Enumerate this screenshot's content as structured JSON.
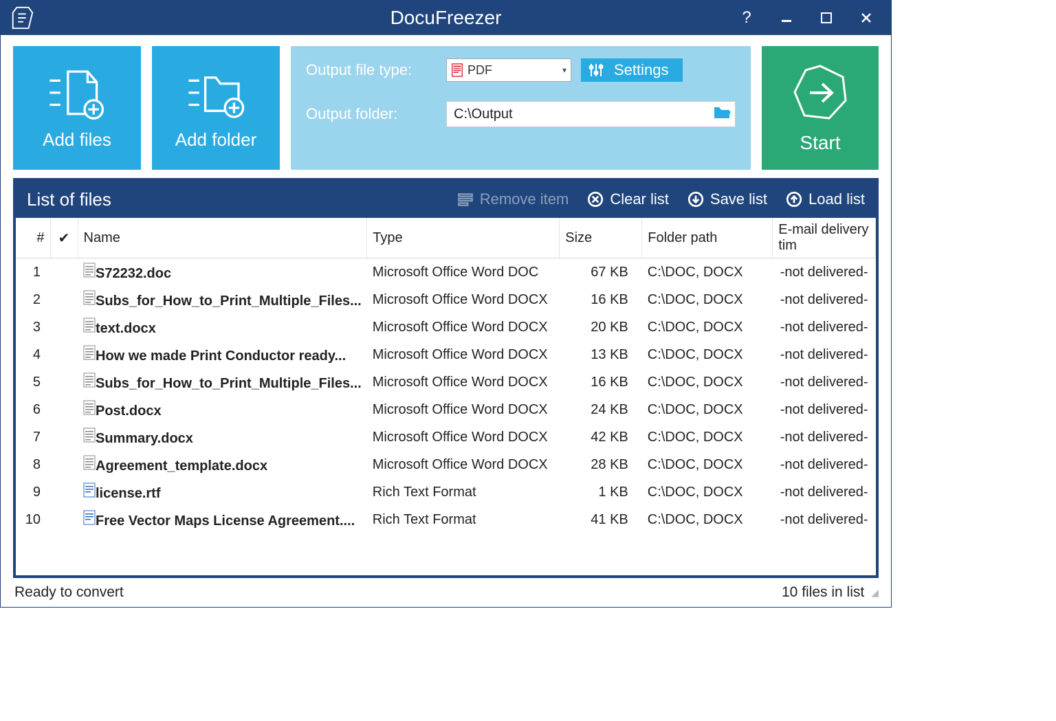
{
  "app_title": "DocuFreezer",
  "toolbar": {
    "add_files": "Add files",
    "add_folder": "Add folder",
    "output_type_label": "Output file type:",
    "output_type_value": "PDF",
    "settings_label": "Settings",
    "output_folder_label": "Output folder:",
    "output_folder_value": "C:\\Output",
    "start_label": "Start"
  },
  "list_panel": {
    "title": "List of files",
    "remove_item": "Remove item",
    "clear_list": "Clear list",
    "save_list": "Save list",
    "load_list": "Load list"
  },
  "columns": {
    "num": "#",
    "check": "✔",
    "name": "Name",
    "type": "Type",
    "size": "Size",
    "folder": "Folder path",
    "email": "E-mail delivery tim"
  },
  "files": [
    {
      "num": "1",
      "name": "S72232.doc",
      "type": "Microsoft Office Word DOC",
      "size": "67 KB",
      "folder": "C:\\DOC, DOCX",
      "email": "-not delivered-",
      "fmt": "doc"
    },
    {
      "num": "2",
      "name": "Subs_for_How_to_Print_Multiple_Files...",
      "type": "Microsoft Office Word DOCX",
      "size": "16 KB",
      "folder": "C:\\DOC, DOCX",
      "email": "-not delivered-",
      "fmt": "docx"
    },
    {
      "num": "3",
      "name": "text.docx",
      "type": "Microsoft Office Word DOCX",
      "size": "20 KB",
      "folder": "C:\\DOC, DOCX",
      "email": "-not delivered-",
      "fmt": "docx"
    },
    {
      "num": "4",
      "name": "How we made Print Conductor ready...",
      "type": "Microsoft Office Word DOCX",
      "size": "13 KB",
      "folder": "C:\\DOC, DOCX",
      "email": "-not delivered-",
      "fmt": "docx"
    },
    {
      "num": "5",
      "name": "Subs_for_How_to_Print_Multiple_Files...",
      "type": "Microsoft Office Word DOCX",
      "size": "16 KB",
      "folder": "C:\\DOC, DOCX",
      "email": "-not delivered-",
      "fmt": "docx"
    },
    {
      "num": "6",
      "name": "Post.docx",
      "type": "Microsoft Office Word DOCX",
      "size": "24 KB",
      "folder": "C:\\DOC, DOCX",
      "email": "-not delivered-",
      "fmt": "docx"
    },
    {
      "num": "7",
      "name": "Summary.docx",
      "type": "Microsoft Office Word DOCX",
      "size": "42 KB",
      "folder": "C:\\DOC, DOCX",
      "email": "-not delivered-",
      "fmt": "docx"
    },
    {
      "num": "8",
      "name": "Agreement_template.docx",
      "type": "Microsoft Office Word DOCX",
      "size": "28 KB",
      "folder": "C:\\DOC, DOCX",
      "email": "-not delivered-",
      "fmt": "docx"
    },
    {
      "num": "9",
      "name": "license.rtf",
      "type": "Rich Text Format",
      "size": "1 KB",
      "folder": "C:\\DOC, DOCX",
      "email": "-not delivered-",
      "fmt": "rtf"
    },
    {
      "num": "10",
      "name": "Free Vector Maps License Agreement....",
      "type": "Rich Text Format",
      "size": "41 KB",
      "folder": "C:\\DOC, DOCX",
      "email": "-not delivered-",
      "fmt": "rtf"
    }
  ],
  "status": {
    "left": "Ready to convert",
    "right": "10 files in list"
  }
}
